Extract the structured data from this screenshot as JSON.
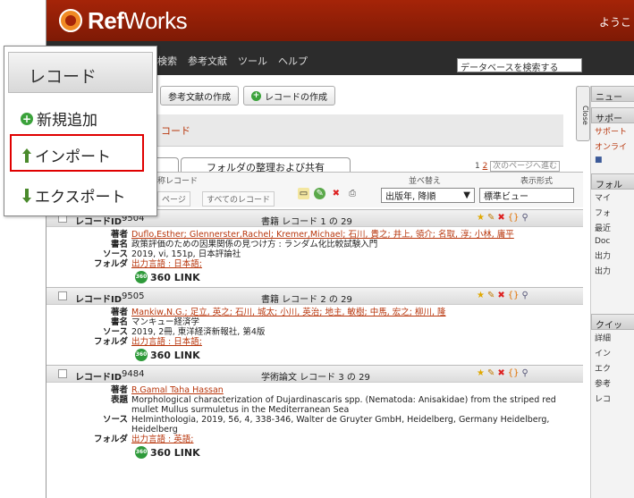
{
  "app": {
    "logo_prefix": "Ref",
    "logo_suffix": "Works",
    "welcome": "ようこ"
  },
  "menu": {
    "items": [
      "検索",
      "参考文献",
      "ツール",
      "ヘルプ"
    ],
    "search_placeholder": "データベースを検索する"
  },
  "toolbar": {
    "bib_button": "参考文献の作成",
    "create_button": "レコードの作成"
  },
  "breadcrumb": {
    "text": "コード"
  },
  "tabs": {
    "folders_tab": "フォルダの整理および共有"
  },
  "pager": {
    "page1": "1",
    "page2": "2",
    "next": "次のページへ進む"
  },
  "controls": {
    "records_label": "称レコード",
    "page_radio": "ページ",
    "all_radio": "すべてのレコード",
    "sort_label": "並べ替え",
    "sort_value": "出版年, 降順",
    "format_label": "表示形式",
    "format_value": "標準ビュー"
  },
  "records": [
    {
      "id_label": "レコードID",
      "id": "9504",
      "type": "書籍 レコード 1 の 29",
      "fields": [
        {
          "k": "著者",
          "v": "Duflo,Esther; Glennerster,Rachel; Kremer,Michael; 石川, 貴之; 井上, 領介; 名取, 淳; 小林, 庸平",
          "link": true
        },
        {
          "k": "書名",
          "v": "政策評価のための因果関係の見つけ方 : ランダム化比較試験入門",
          "link": false
        },
        {
          "k": "ソース",
          "v": "2019, vi, 151p, 日本評論社",
          "link": false
        },
        {
          "k": "フォルダ",
          "v": "出力言語 : 日本語;",
          "link": true
        }
      ],
      "link360": "360 LINK"
    },
    {
      "id_label": "レコードID",
      "id": "9505",
      "type": "書籍 レコード 2 の 29",
      "fields": [
        {
          "k": "著者",
          "v": "Mankiw,N.G.; 足立, 英之; 石川, 城太; 小川, 英治; 地主, 敏樹; 中馬, 宏之; 柳川, 隆",
          "link": true
        },
        {
          "k": "書名",
          "v": "マンキュー経済学",
          "link": false
        },
        {
          "k": "ソース",
          "v": "2019, 2冊, 東洋経済新報社, 第4版",
          "link": false
        },
        {
          "k": "フォルダ",
          "v": "出力言語 : 日本語;",
          "link": true
        }
      ],
      "link360": "360 LINK"
    },
    {
      "id_label": "レコードID",
      "id": "9484",
      "type": "学術論文 レコード 3 の 29",
      "fields": [
        {
          "k": "著者",
          "v": "R.Gamal Taha Hassan",
          "link": true
        },
        {
          "k": "表題",
          "v": "Morphological characterization of Dujardinascaris spp. (Nematoda: Anisakidae) from the striped red mullet Mullus surmuletus in the Mediterranean Sea",
          "link": false
        },
        {
          "k": "ソース",
          "v": "Helminthologia, 2019, 56, 4, 338-346, Walter de Gruyter GmbH, Heidelberg, Germany Heidelberg, Heidelberg",
          "link": false
        },
        {
          "k": "フォルダ",
          "v": "出力言語 : 英語;",
          "link": true
        }
      ],
      "link360": "360 LINK"
    }
  ],
  "close_tab": "Close",
  "right_panel": {
    "news_head": "ニュー",
    "support_head": "サポー",
    "support_lines": [
      "サポート",
      "オンライ"
    ],
    "folders_head": "フォル",
    "folder_items": [
      "マイ",
      "フォ",
      "最近",
      "Doc",
      "出力",
      "出力"
    ],
    "quick_head": "クイッ",
    "quick_items": [
      "詳細",
      "イン",
      "エク",
      "参考",
      "レコ"
    ]
  },
  "popup": {
    "header": "レコード",
    "items": [
      "新規追加",
      "インポート",
      "エクスポート"
    ]
  },
  "colors": {
    "header": "#a52408",
    "accent": "#b8360c",
    "highlight": "#e00000"
  }
}
